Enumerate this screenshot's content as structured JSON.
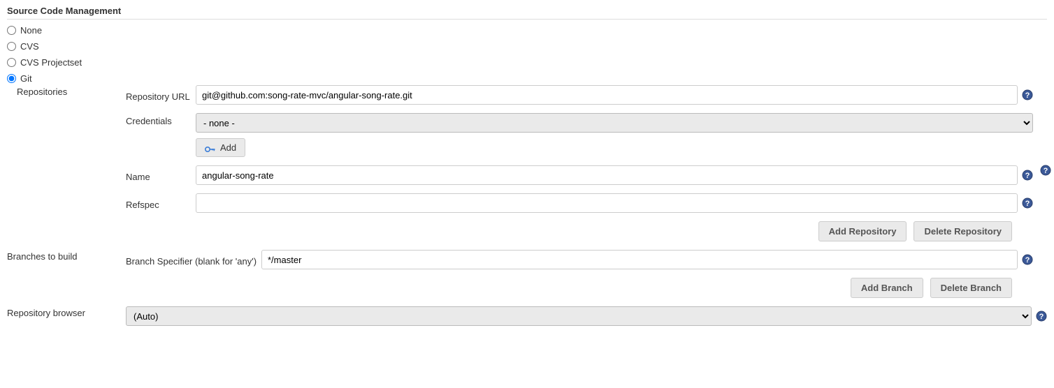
{
  "section": {
    "title": "Source Code Management"
  },
  "scm_options": {
    "none": "None",
    "cvs": "CVS",
    "cvs_projectset": "CVS Projectset",
    "git": "Git",
    "selected": "git"
  },
  "git": {
    "repositories_label": "Repositories",
    "repo_url_label": "Repository URL",
    "repo_url_value": "git@github.com:song-rate-mvc/angular-song-rate.git",
    "credentials_label": "Credentials",
    "credentials_selected": "- none -",
    "add_button": "Add",
    "name_label": "Name",
    "name_value": "angular-song-rate",
    "refspec_label": "Refspec",
    "refspec_value": "",
    "add_repo_button": "Add Repository",
    "delete_repo_button": "Delete Repository"
  },
  "branches": {
    "section_label": "Branches to build",
    "specifier_label": "Branch Specifier (blank for 'any')",
    "specifier_value": "*/master",
    "add_branch_button": "Add Branch",
    "delete_branch_button": "Delete Branch"
  },
  "repo_browser": {
    "label": "Repository browser",
    "selected": "(Auto)"
  }
}
